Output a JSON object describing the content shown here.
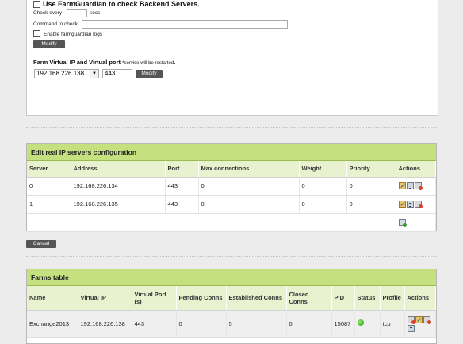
{
  "farmguardian": {
    "title": "Use FarmGuardian to check Backend Servers.",
    "check_every_label": "Check every",
    "check_every_value": "",
    "secs_label": "secs.",
    "command_label": "Command to check",
    "command_value": "",
    "logs_label": "Enable farmguardian logs",
    "modify_label": "Modify"
  },
  "vip": {
    "title": "Farm Virtual IP and Virtual port",
    "note": "*service will be restarted",
    "ip_value": "192.168.226.138",
    "port_value": "443",
    "modify_label": "Modify"
  },
  "servers": {
    "title": "Edit real IP servers configuration",
    "columns": [
      "Server",
      "Address",
      "Port",
      "Max connections",
      "Weight",
      "Priority",
      "Actions"
    ],
    "rows": [
      {
        "server": "0",
        "address": "192.168.226.134",
        "port": "443",
        "maxconn": "0",
        "weight": "0",
        "priority": "0"
      },
      {
        "server": "1",
        "address": "192.168.226.135",
        "port": "443",
        "maxconn": "0",
        "weight": "0",
        "priority": "0"
      }
    ],
    "cancel_label": "Cancel"
  },
  "farms": {
    "title": "Farms table",
    "columns": [
      "Name",
      "Virtual IP",
      "Virtual Port (s)",
      "Pending Conns",
      "Established Conns",
      "Closed Conns",
      "PID",
      "Status",
      "Profile",
      "Actions"
    ],
    "rows": [
      {
        "name": "Exchange2013",
        "vip": "192.168.226.138",
        "vport": "443",
        "pending": "0",
        "established": "5",
        "closed": "0",
        "pid": "15087",
        "status": "up",
        "profile": "tcp"
      }
    ]
  },
  "colors": {
    "header_green": "#c5e07e",
    "status_up": "#2a9d14",
    "button": "#555555"
  }
}
